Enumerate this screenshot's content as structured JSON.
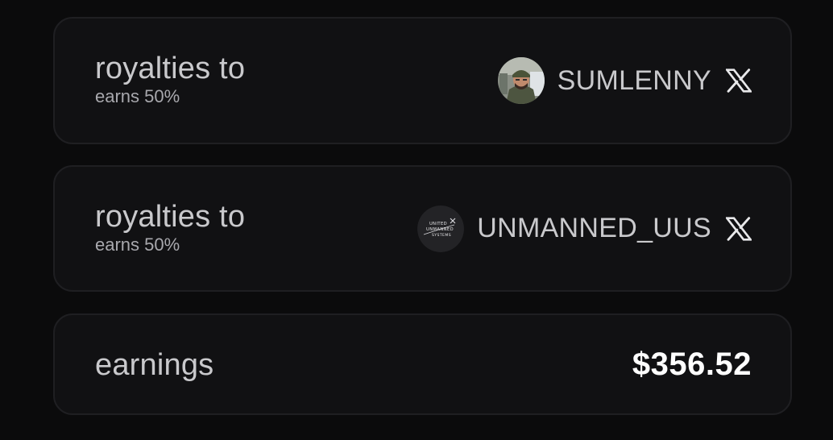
{
  "royalties": [
    {
      "label": "royalties to",
      "share": "earns 50%",
      "handle": "SUMLENNY",
      "avatar_icon": "person-photo-avatar",
      "social_icon": "x-logo-icon"
    },
    {
      "label": "royalties to",
      "share": "earns 50%",
      "handle": "UNMANNED_UUS",
      "avatar_icon": "united-unmanned-systems-logo",
      "avatar_text": [
        "UNITED",
        "UNMANNED",
        "SYSTEMS"
      ],
      "social_icon": "x-logo-icon"
    }
  ],
  "earnings": {
    "label": "earnings",
    "amount": "$356.52"
  },
  "colors": {
    "background": "#0b0b0c",
    "card": "#111113",
    "border": "#1f1f22",
    "text": "#c9c9cc",
    "amount": "#ffffff"
  }
}
